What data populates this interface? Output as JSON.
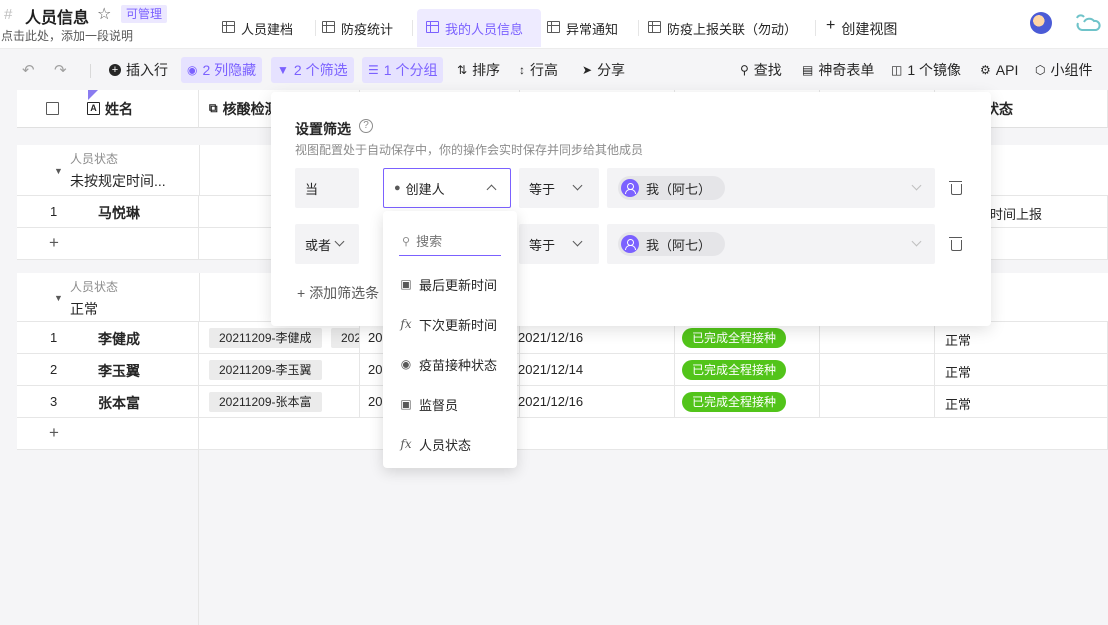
{
  "header": {
    "title": "人员信息",
    "badge": "可管理",
    "subtitle": "点击此处，添加一段说明",
    "tabs": [
      {
        "label": "人员建档"
      },
      {
        "label": "防疫统计"
      },
      {
        "label": "我的人员信息"
      },
      {
        "label": "异常通知"
      },
      {
        "label": "防疫上报关联（勿动）"
      }
    ],
    "create_view": "创建视图"
  },
  "toolbar": {
    "insert_row": "插入行",
    "hidden_cols": "2 列隐藏",
    "filters": "2 个筛选",
    "groups": "1 个分组",
    "sort": "排序",
    "row_height": "行高",
    "share": "分享",
    "find": "查找",
    "magic_form": "神奇表单",
    "mirror": "1 个镜像",
    "api": "API",
    "widget": "小组件"
  },
  "grid": {
    "columns": [
      "姓名",
      "核酸检测",
      "状态"
    ],
    "group1": {
      "label": "人员状态",
      "value": "未按规定时间...",
      "rows": [
        {
          "num": "1",
          "name": "马悦琳",
          "status": "定时间上报"
        }
      ]
    },
    "group2": {
      "label": "人员状态",
      "value": "正常",
      "rows": [
        {
          "num": "1",
          "name": "李健成",
          "tag": "20211209-李健成",
          "tag2": "202",
          "c3": "20",
          "date": "2021/12/16",
          "badge": "已完成全程接种",
          "status": "正常"
        },
        {
          "num": "2",
          "name": "李玉翼",
          "tag": "20211209-李玉翼",
          "c3": "20",
          "date": "2021/12/14",
          "badge": "已完成全程接种",
          "status": "正常"
        },
        {
          "num": "3",
          "name": "张本富",
          "tag": "20211209-张本富",
          "c3": "20",
          "date": "2021/12/16",
          "badge": "已完成全程接种",
          "status": "正常"
        }
      ]
    },
    "add_row": "+"
  },
  "filter": {
    "title": "设置筛选",
    "description": "视图配置处于自动保存中，你的操作会实时保存并同步给其他成员",
    "rows": [
      {
        "conj": "当",
        "field": "创建人",
        "op": "等于",
        "value": "我（阿七）"
      },
      {
        "conj": "或者",
        "op": "等于",
        "value": "我（阿七）"
      }
    ],
    "add_condition": "添加筛选条"
  },
  "dropdown": {
    "search_placeholder": "搜索",
    "items": [
      {
        "label": "最后更新时间",
        "icon": "calendar-edit-icon"
      },
      {
        "label": "下次更新时间",
        "icon": "formula-icon"
      },
      {
        "label": "疫苗接种状态",
        "icon": "single-select-icon"
      },
      {
        "label": "监督员",
        "icon": "calendar-edit-icon"
      },
      {
        "label": "人员状态",
        "icon": "formula-icon"
      }
    ]
  },
  "colors": {
    "accent": "#7b61ff",
    "success": "#52c41a"
  }
}
